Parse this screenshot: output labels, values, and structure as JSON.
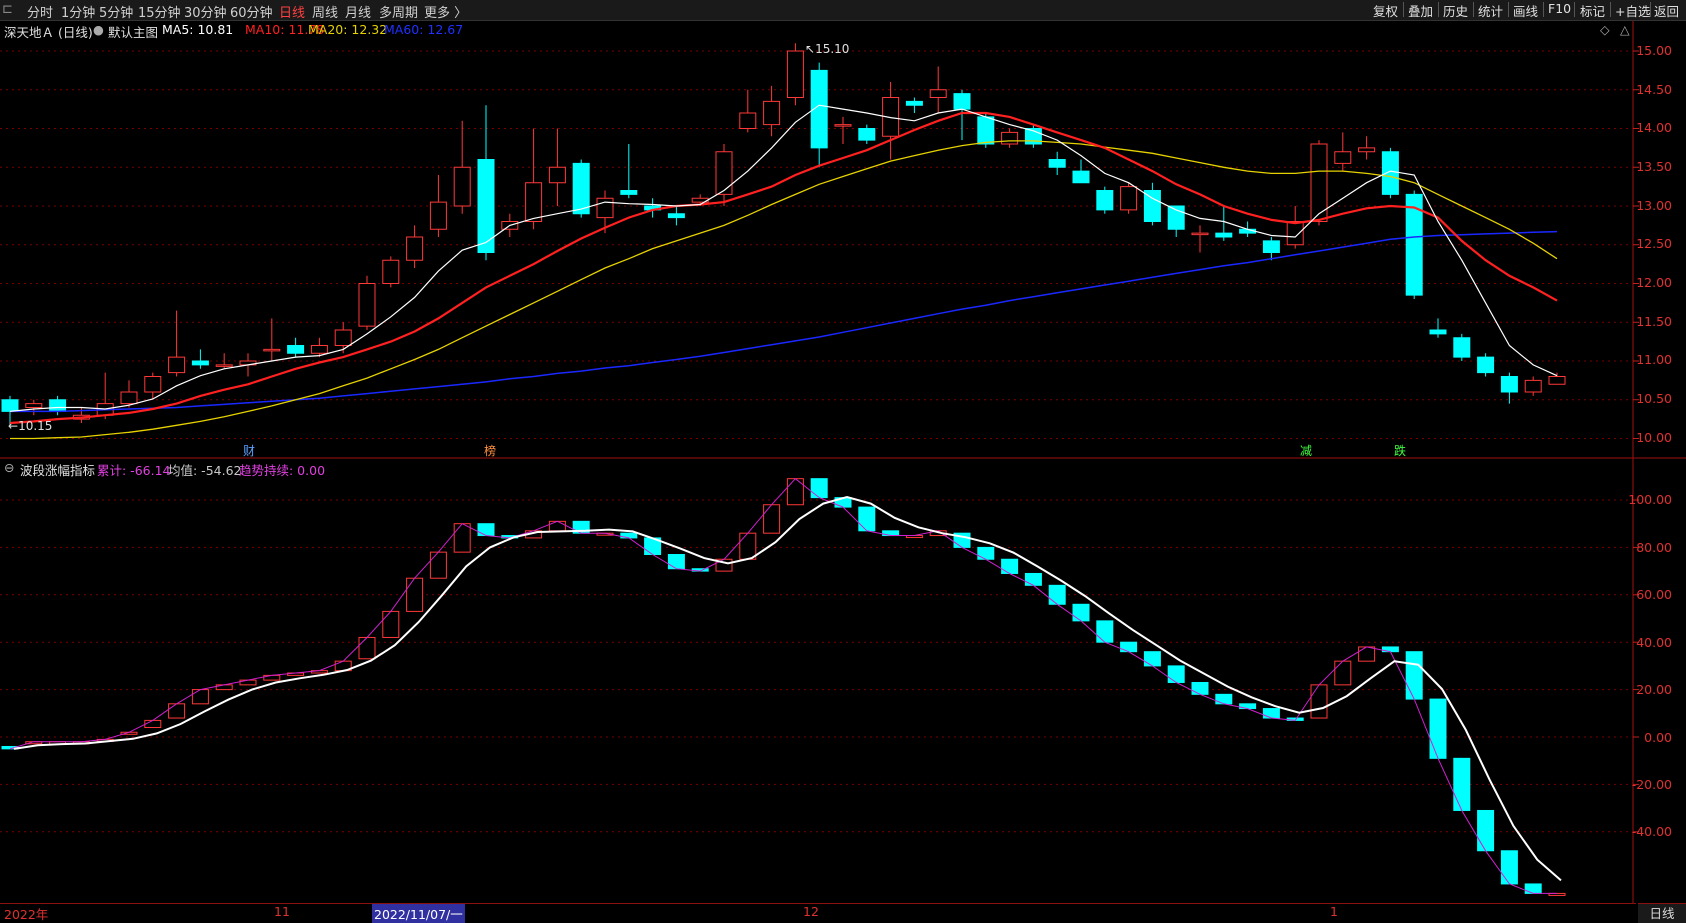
{
  "toolbar": {
    "left_items": [
      "分时",
      "1分钟",
      "5分钟",
      "15分钟",
      "30分钟",
      "60分钟",
      "日线",
      "周线",
      "月线",
      "多周期",
      "更多 〉"
    ],
    "active": "日线",
    "right_items": [
      "复权",
      "叠加",
      "历史",
      "统计",
      "画线",
      "F10",
      "标记",
      "+自选",
      "返回"
    ]
  },
  "main_legend": {
    "title": "深天地Ａ (日线)",
    "template": "默认主图",
    "ma": [
      {
        "label": "MA5: 10.81",
        "color": "#ffffff"
      },
      {
        "label": "MA10: 11.78",
        "color": "#ff2020"
      },
      {
        "label": "MA20: 12.32",
        "color": "#e6d200"
      },
      {
        "label": "MA60: 12.67",
        "color": "#2030ff"
      }
    ]
  },
  "sub_legend": {
    "title": "波段涨幅指标",
    "items": [
      {
        "label": "累计: -66.14",
        "color": "#e040e0"
      },
      {
        "label": "均值: -54.62",
        "color": "#c8c8c8"
      },
      {
        "label": "趋势持续: 0.00",
        "color": "#e040e0"
      }
    ]
  },
  "price_axis": [
    "15.00",
    "14.50",
    "14.00",
    "13.50",
    "13.00",
    "12.50",
    "12.00",
    "11.50",
    "11.00",
    "10.50",
    "10.00"
  ],
  "osc_axis": [
    "100.00",
    "80.00",
    "60.00",
    "40.00",
    "20.00",
    "0.00",
    "-20.00",
    "-40.00"
  ],
  "annotations": {
    "high": "15.10",
    "low": "10.15"
  },
  "event_markers": [
    {
      "text": "财",
      "color": "#5aa0ff"
    },
    {
      "text": "榜",
      "color": "#ff9040"
    },
    {
      "text": "减",
      "color": "#40ff40"
    },
    {
      "text": "跌",
      "color": "#40ff40"
    }
  ],
  "dates": [
    {
      "text": "2022年",
      "sel": false
    },
    {
      "text": "11",
      "sel": false
    },
    {
      "text": "2022/11/07/一",
      "sel": true
    },
    {
      "text": "12",
      "sel": false
    },
    {
      "text": "1",
      "sel": false
    }
  ],
  "period_button": "日线",
  "colors": {
    "up": "#ff3838",
    "down": "#00ffff",
    "grid": "#7a0000",
    "ma5": "#ffffff",
    "ma10": "#ff2020",
    "ma20": "#e6d200",
    "ma60": "#1a28ff"
  },
  "chart_data": {
    "type": "candlestick",
    "candles": [
      [
        10.5,
        10.35,
        10.55,
        10.15
      ],
      [
        10.4,
        10.45,
        10.5,
        10.3
      ],
      [
        10.5,
        10.35,
        10.55,
        10.3
      ],
      [
        10.25,
        10.3,
        10.4,
        10.2
      ],
      [
        10.3,
        10.45,
        10.85,
        10.25
      ],
      [
        10.45,
        10.6,
        10.75,
        10.4
      ],
      [
        10.6,
        10.8,
        10.85,
        10.5
      ],
      [
        10.85,
        11.05,
        11.65,
        10.8
      ],
      [
        11.0,
        10.95,
        11.15,
        10.9
      ],
      [
        10.95,
        10.95,
        11.1,
        10.9
      ],
      [
        10.95,
        11.0,
        11.1,
        10.8
      ],
      [
        11.15,
        11.15,
        11.55,
        11.0
      ],
      [
        11.2,
        11.1,
        11.3,
        11.05
      ],
      [
        11.1,
        11.2,
        11.3,
        11.05
      ],
      [
        11.2,
        11.4,
        11.5,
        11.1
      ],
      [
        11.45,
        12.0,
        12.1,
        11.4
      ],
      [
        12.0,
        12.3,
        12.35,
        11.95
      ],
      [
        12.3,
        12.6,
        12.75,
        12.2
      ],
      [
        12.7,
        13.05,
        13.4,
        12.6
      ],
      [
        13.0,
        13.5,
        14.1,
        12.9
      ],
      [
        13.6,
        12.4,
        14.3,
        12.3
      ],
      [
        12.7,
        12.8,
        12.9,
        12.6
      ],
      [
        12.8,
        13.3,
        14.0,
        12.7
      ],
      [
        13.3,
        13.5,
        14.0,
        13.0
      ],
      [
        13.55,
        12.9,
        13.6,
        12.85
      ],
      [
        12.85,
        13.1,
        13.2,
        12.65
      ],
      [
        13.2,
        13.15,
        13.8,
        13.1
      ],
      [
        13.0,
        12.95,
        13.1,
        12.85
      ],
      [
        12.9,
        12.85,
        13.0,
        12.75
      ],
      [
        13.05,
        13.1,
        13.15,
        13.0
      ],
      [
        13.15,
        13.7,
        13.8,
        13.0
      ],
      [
        14.0,
        14.2,
        14.5,
        13.95
      ],
      [
        14.05,
        14.35,
        14.55,
        13.9
      ],
      [
        14.4,
        15.0,
        15.1,
        14.3
      ],
      [
        14.75,
        13.75,
        14.85,
        13.5
      ],
      [
        14.05,
        14.05,
        14.15,
        13.8
      ],
      [
        14.0,
        13.85,
        14.05,
        13.8
      ],
      [
        13.9,
        14.4,
        14.6,
        13.6
      ],
      [
        14.35,
        14.3,
        14.4,
        14.2
      ],
      [
        14.4,
        14.5,
        14.8,
        14.2
      ],
      [
        14.45,
        14.25,
        14.5,
        13.85
      ],
      [
        14.15,
        13.8,
        14.2,
        13.75
      ],
      [
        13.8,
        13.95,
        14.0,
        13.75
      ],
      [
        14.0,
        13.8,
        14.05,
        13.75
      ],
      [
        13.6,
        13.5,
        13.7,
        13.4
      ],
      [
        13.45,
        13.3,
        13.6,
        13.3
      ],
      [
        13.2,
        12.95,
        13.25,
        12.9
      ],
      [
        12.95,
        13.25,
        13.3,
        12.9
      ],
      [
        13.2,
        12.8,
        13.3,
        12.75
      ],
      [
        13.0,
        12.7,
        13.0,
        12.6
      ],
      [
        12.65,
        12.65,
        12.75,
        12.4
      ],
      [
        12.65,
        12.6,
        13.0,
        12.55
      ],
      [
        12.7,
        12.65,
        12.8,
        12.6
      ],
      [
        12.55,
        12.4,
        12.6,
        12.3
      ],
      [
        12.5,
        12.8,
        13.0,
        12.45
      ],
      [
        12.8,
        13.8,
        13.85,
        12.75
      ],
      [
        13.55,
        13.7,
        13.95,
        13.45
      ],
      [
        13.7,
        13.75,
        13.9,
        13.6
      ],
      [
        13.7,
        13.15,
        13.75,
        13.1
      ],
      [
        13.15,
        11.85,
        13.2,
        11.8
      ],
      [
        11.4,
        11.35,
        11.55,
        11.3
      ],
      [
        11.3,
        11.05,
        11.35,
        11.0
      ],
      [
        11.05,
        10.85,
        11.1,
        10.8
      ],
      [
        10.8,
        10.6,
        10.85,
        10.45
      ],
      [
        10.6,
        10.75,
        10.8,
        10.55
      ],
      [
        10.7,
        10.8,
        10.85,
        10.7
      ]
    ],
    "osc": [
      [
        -4,
        -5
      ],
      [
        -2,
        -2
      ],
      [
        -3,
        -2
      ],
      [
        -2,
        -2
      ],
      [
        -1,
        -1
      ],
      [
        2,
        2
      ],
      [
        4,
        7
      ],
      [
        8,
        14
      ],
      [
        14,
        20
      ],
      [
        20,
        22
      ],
      [
        22,
        24
      ],
      [
        24,
        26
      ],
      [
        26,
        27
      ],
      [
        27,
        28
      ],
      [
        28,
        32
      ],
      [
        33,
        42
      ],
      [
        42,
        53
      ],
      [
        53,
        67
      ],
      [
        67,
        78
      ],
      [
        78,
        90
      ],
      [
        90,
        85
      ],
      [
        85,
        84
      ],
      [
        84,
        87
      ],
      [
        87,
        91
      ],
      [
        91,
        86
      ],
      [
        86,
        86
      ],
      [
        86,
        84
      ],
      [
        84,
        77
      ],
      [
        77,
        71
      ],
      [
        71,
        70
      ],
      [
        70,
        75
      ],
      [
        75,
        86
      ],
      [
        86,
        98
      ],
      [
        98,
        109
      ],
      [
        109,
        101
      ],
      [
        101,
        97
      ],
      [
        97,
        87
      ],
      [
        87,
        85
      ],
      [
        85,
        85
      ],
      [
        85,
        87
      ],
      [
        86,
        80
      ],
      [
        80,
        75
      ],
      [
        75,
        69
      ],
      [
        69,
        64
      ],
      [
        64,
        56
      ],
      [
        56,
        49
      ],
      [
        49,
        40
      ],
      [
        40,
        36
      ],
      [
        36,
        30
      ],
      [
        30,
        23
      ],
      [
        23,
        18
      ],
      [
        18,
        14
      ],
      [
        14,
        12
      ],
      [
        12,
        8
      ],
      [
        8,
        7
      ],
      [
        8,
        22
      ],
      [
        22,
        32
      ],
      [
        32,
        38
      ],
      [
        38,
        36
      ],
      [
        36,
        16
      ],
      [
        16,
        -9
      ],
      [
        -9,
        -31
      ],
      [
        -31,
        -48
      ],
      [
        -48,
        -62
      ],
      [
        -62,
        -66
      ],
      [
        -66,
        -66
      ]
    ],
    "ma5": [
      10.35,
      10.38,
      10.4,
      10.4,
      10.38,
      10.43,
      10.51,
      10.68,
      10.81,
      10.9,
      10.95,
      11.0,
      11.05,
      11.07,
      11.15,
      11.35,
      11.57,
      11.82,
      12.16,
      12.43,
      12.53,
      12.75,
      12.84,
      12.9,
      12.96,
      13.05,
      13.03,
      13.02,
      13.0,
      13.02,
      13.2,
      13.45,
      13.75,
      14.08,
      14.3,
      14.25,
      14.2,
      14.14,
      14.1,
      14.2,
      14.25,
      14.15,
      14.05,
      13.97,
      13.85,
      13.65,
      13.42,
      13.3,
      13.1,
      12.95,
      12.84,
      12.8,
      12.7,
      12.62,
      12.6,
      12.9,
      13.1,
      13.3,
      13.45,
      13.4,
      12.8,
      12.3,
      11.75,
      11.2,
      10.95,
      10.81
    ],
    "ma10": [
      10.2,
      10.22,
      10.25,
      10.27,
      10.3,
      10.33,
      10.38,
      10.45,
      10.55,
      10.63,
      10.7,
      10.8,
      10.9,
      10.98,
      11.05,
      11.15,
      11.25,
      11.38,
      11.55,
      11.75,
      11.95,
      12.1,
      12.25,
      12.42,
      12.58,
      12.72,
      12.85,
      12.95,
      13.0,
      13.02,
      13.05,
      13.15,
      13.25,
      13.4,
      13.52,
      13.62,
      13.72,
      13.85,
      13.98,
      14.1,
      14.2,
      14.2,
      14.15,
      14.05,
      13.95,
      13.85,
      13.75,
      13.6,
      13.45,
      13.28,
      13.15,
      13.0,
      12.9,
      12.82,
      12.78,
      12.82,
      12.9,
      12.97,
      13.0,
      12.98,
      12.85,
      12.55,
      12.3,
      12.1,
      11.95,
      11.78
    ],
    "ma20": [
      10.0,
      10.0,
      10.01,
      10.02,
      10.05,
      10.08,
      10.12,
      10.17,
      10.22,
      10.28,
      10.35,
      10.42,
      10.5,
      10.58,
      10.68,
      10.78,
      10.9,
      11.02,
      11.15,
      11.3,
      11.45,
      11.6,
      11.75,
      11.9,
      12.05,
      12.2,
      12.32,
      12.45,
      12.55,
      12.65,
      12.75,
      12.88,
      13.02,
      13.15,
      13.28,
      13.38,
      13.48,
      13.58,
      13.65,
      13.72,
      13.78,
      13.82,
      13.84,
      13.84,
      13.82,
      13.8,
      13.76,
      13.72,
      13.68,
      13.62,
      13.56,
      13.5,
      13.45,
      13.42,
      13.42,
      13.45,
      13.45,
      13.42,
      13.38,
      13.3,
      13.15,
      13.0,
      12.85,
      12.7,
      12.52,
      12.32
    ],
    "ma60": [
      10.35,
      10.35,
      10.35,
      10.36,
      10.37,
      10.38,
      10.39,
      10.4,
      10.42,
      10.44,
      10.46,
      10.48,
      10.5,
      10.52,
      10.55,
      10.58,
      10.61,
      10.64,
      10.67,
      10.7,
      10.73,
      10.77,
      10.8,
      10.84,
      10.87,
      10.91,
      10.94,
      10.98,
      11.02,
      11.06,
      11.11,
      11.16,
      11.21,
      11.26,
      11.31,
      11.37,
      11.43,
      11.49,
      11.55,
      11.61,
      11.67,
      11.72,
      11.78,
      11.83,
      11.88,
      11.93,
      11.98,
      12.03,
      12.08,
      12.13,
      12.18,
      12.23,
      12.27,
      12.32,
      12.37,
      12.42,
      12.47,
      12.52,
      12.57,
      12.6,
      12.62,
      12.63,
      12.64,
      12.65,
      12.66,
      12.67
    ]
  }
}
